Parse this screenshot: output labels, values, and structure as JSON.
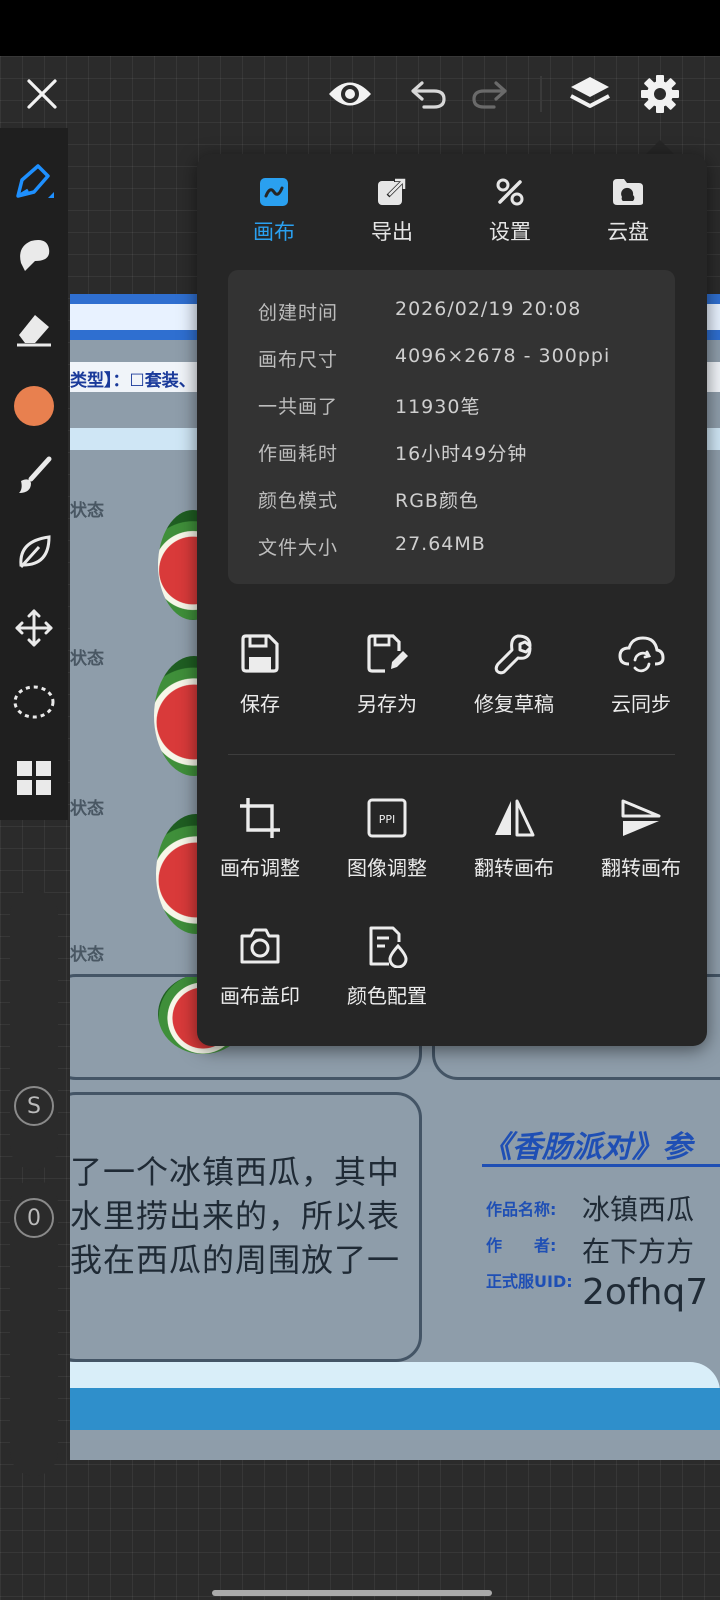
{
  "toolbar": {
    "close_icon": "close-icon",
    "preview_icon": "eye-icon",
    "undo_icon": "undo-icon",
    "redo_icon": "redo-icon",
    "layers_icon": "layers-icon",
    "settings_icon": "gear-icon"
  },
  "left_tools": {
    "items": [
      "pen-tool",
      "smudge-tool",
      "eraser-tool",
      "brush-tool",
      "leaf-tool",
      "move-tool",
      "lasso-tool",
      "grid-tool"
    ],
    "current_color": "#e8804f",
    "size_slider_label": "S",
    "opacity_slider_label": "0"
  },
  "panel": {
    "tabs": [
      {
        "label": "画布",
        "icon": "canvas-icon",
        "active": true
      },
      {
        "label": "导出",
        "icon": "export-icon",
        "active": false
      },
      {
        "label": "设置",
        "icon": "settings-tools-icon",
        "active": false
      },
      {
        "label": "云盘",
        "icon": "cloud-drive-icon",
        "active": false
      }
    ],
    "info": [
      {
        "key": "创建时间",
        "value": "2026/02/19 20:08"
      },
      {
        "key": "画布尺寸",
        "value": "4096×2678 - 300ppi"
      },
      {
        "key": "一共画了",
        "value": "11930笔"
      },
      {
        "key": "作画耗时",
        "value": "16小时49分钟"
      },
      {
        "key": "颜色模式",
        "value": "RGB颜色"
      },
      {
        "key": "文件大小",
        "value": "27.64MB"
      }
    ],
    "actions_row1": [
      {
        "label": "保存",
        "icon": "save-icon"
      },
      {
        "label": "另存为",
        "icon": "save-as-icon"
      },
      {
        "label": "修复草稿",
        "icon": "wrench-icon"
      },
      {
        "label": "云同步",
        "icon": "cloud-sync-icon"
      }
    ],
    "actions_row2": [
      {
        "label": "画布调整",
        "icon": "crop-icon"
      },
      {
        "label": "图像调整",
        "icon": "ppi-icon"
      },
      {
        "label": "翻转画布",
        "icon": "flip-horizontal-icon"
      },
      {
        "label": "翻转画布",
        "icon": "flip-vertical-icon"
      }
    ],
    "actions_row3": [
      {
        "label": "画布盖印",
        "icon": "camera-icon"
      },
      {
        "label": "颜色配置",
        "icon": "color-profile-icon"
      }
    ],
    "accent_color": "#2aa0f0"
  },
  "artwork": {
    "type_line": "类型】：☐套装、",
    "state_label": "状态",
    "story_lines": [
      "了一个冰镇西瓜，其中",
      "水里捞出来的，所以表",
      "我在西瓜的周围放了一"
    ],
    "title": "《香肠派对》参",
    "info_labels": [
      "作品名称:",
      "作　　者:",
      "正式服UID:"
    ],
    "info_values": [
      "冰镇西瓜",
      "在下方方",
      "2ofhq7"
    ]
  }
}
